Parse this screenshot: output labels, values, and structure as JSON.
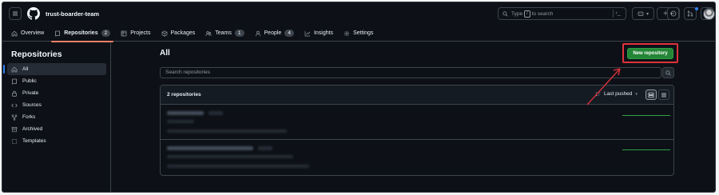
{
  "header": {
    "org_name": "trust-boarder-team",
    "search_prefix": "Type",
    "search_key": "/",
    "search_suffix": "to search",
    "search_cmd_icon": "command-palette-icon",
    "notification_dot_color": "#2f81f7"
  },
  "tabs": [
    {
      "label": "Overview",
      "icon": "home-icon"
    },
    {
      "label": "Repositories",
      "count": "2",
      "icon": "repo-icon",
      "active": true
    },
    {
      "label": "Projects",
      "icon": "table-icon"
    },
    {
      "label": "Packages",
      "icon": "package-icon"
    },
    {
      "label": "Teams",
      "count": "1",
      "icon": "people-icon"
    },
    {
      "label": "People",
      "count": "4",
      "icon": "person-icon"
    },
    {
      "label": "Insights",
      "icon": "graph-icon"
    },
    {
      "label": "Settings",
      "icon": "gear-icon"
    }
  ],
  "sidebar": {
    "title": "Repositories",
    "items": [
      {
        "label": "All",
        "icon": "home-icon",
        "active": true
      },
      {
        "label": "Public",
        "icon": "repo-icon"
      },
      {
        "label": "Private",
        "icon": "lock-icon"
      },
      {
        "label": "Sources",
        "icon": "code-icon"
      },
      {
        "label": "Forks",
        "icon": "fork-icon"
      },
      {
        "label": "Archived",
        "icon": "archive-icon"
      },
      {
        "label": "Templates",
        "icon": "template-icon"
      }
    ]
  },
  "main": {
    "title": "All",
    "new_button_label": "New repository",
    "search_placeholder": "Search repositories",
    "repo_count_label": "2 repositories",
    "sort_label": "Last pushed",
    "accent_color": "#238636",
    "highlight_color": "#e0323c"
  }
}
